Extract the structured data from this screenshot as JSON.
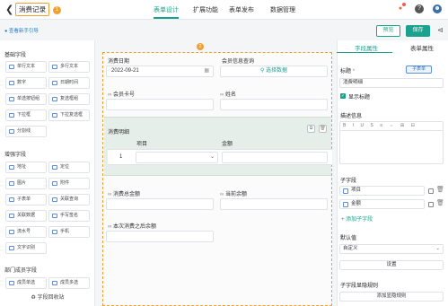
{
  "header": {
    "record_title": "消费记录",
    "marker1": "1",
    "tabs": [
      "表单设计",
      "扩展功能",
      "表单发布",
      "数据管理"
    ],
    "active_tab_color": "#1aa28e",
    "icons": [
      "bell-icon",
      "help-icon",
      "user-avatar"
    ]
  },
  "subbar": {
    "guide_text": "查看新手引导",
    "preview_label": "预览",
    "save_label": "保存",
    "share_icon": "share-icon"
  },
  "left_panel": {
    "sections": [
      {
        "title": "基础字段",
        "items": [
          "单行文本",
          "多行文本",
          "数字",
          "日期时间",
          "单选按钮组",
          "复选框组",
          "下拉框",
          "下拉复选框",
          "分割线"
        ]
      },
      {
        "title": "增强字段",
        "items": [
          "地址",
          "定位",
          "图片",
          "附件",
          "子表单",
          "关联查询",
          "关联数据",
          "手写签名",
          "流水号",
          "手机",
          "文字识别"
        ]
      },
      {
        "title": "部门成员字段",
        "items": [
          "成员单选",
          "成员多选"
        ]
      }
    ],
    "recycle_label": "字段回收站"
  },
  "canvas": {
    "marker2": "2",
    "date_label": "消费日期",
    "date_value": "2022-09-21",
    "member_query_label": "会员信息查询",
    "select_data_label": "选择数据",
    "card_label": "会员卡号",
    "name_label": "姓名",
    "detail_label": "消费明细",
    "detail_columns": [
      "项目",
      "金额"
    ],
    "detail_row_index": "1",
    "total_label": "消费总金额",
    "balance_label": "当前余额",
    "after_balance_label": "本次消费之后余额"
  },
  "right_panel": {
    "tabs": [
      "字段属性",
      "表单属性"
    ],
    "title_label": "标题",
    "title_tag": "子表单",
    "title_value": "消费明细",
    "show_title_label": "显示标题",
    "desc_label": "描述信息",
    "desc_toolbar": "B I U S ≡ ⇔ ⊞ ⊟",
    "subfields_label": "子字段",
    "subfields": [
      "项目",
      "金额"
    ],
    "add_subfield_label": "+ 添加子字段",
    "default_label": "默认值",
    "default_value": "自定义",
    "settings_label": "设置",
    "display_rule_label": "子字段显隐规则",
    "add_rule_label": "添加显隐规则"
  }
}
